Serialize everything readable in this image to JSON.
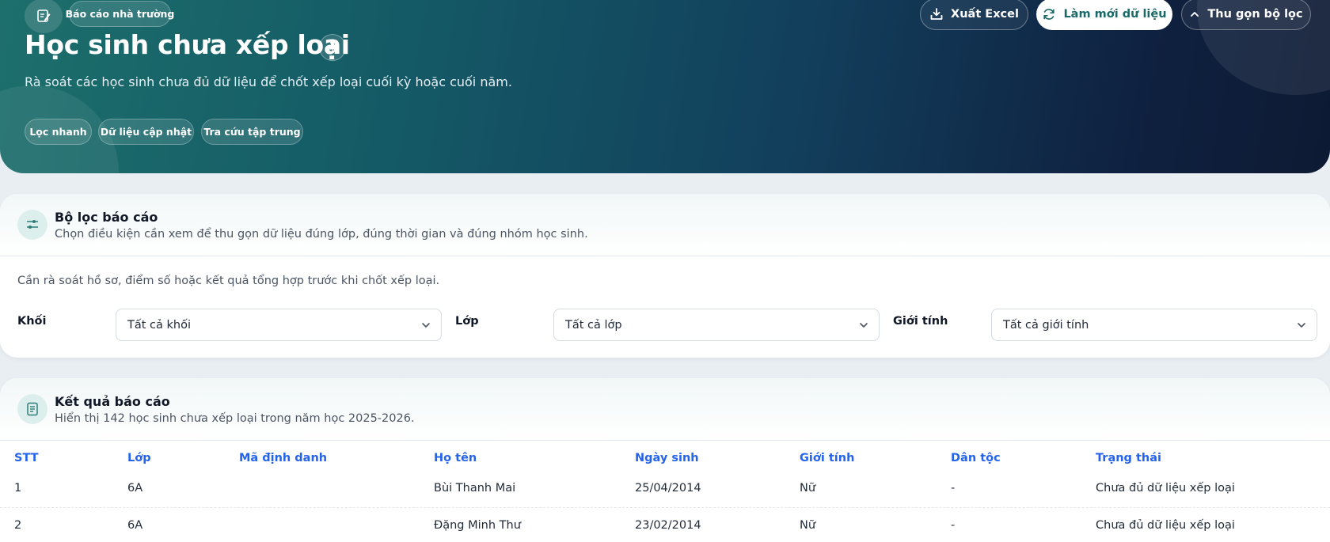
{
  "hero": {
    "badge": "Báo cáo nhà trường",
    "title": "Học sinh chưa xếp loại",
    "subtitle": "Rà soát các học sinh chưa đủ dữ liệu để chốt xếp loại cuối kỳ hoặc cuối năm.",
    "chips": [
      "Lọc nhanh",
      "Dữ liệu cập nhật",
      "Tra cứu tập trung"
    ],
    "actions": {
      "export": "Xuất Excel",
      "refresh": "Làm mới dữ liệu",
      "collapse": "Thu gọn bộ lọc"
    }
  },
  "filters": {
    "title": "Bộ lọc báo cáo",
    "description": "Chọn điều kiện cần xem để thu gọn dữ liệu đúng lớp, đúng thời gian và đúng nhóm học sinh.",
    "note": "Cần rà soát hồ sơ, điểm số hoặc kết quả tổng hợp trước khi chốt xếp loại.",
    "fields": [
      {
        "label": "Khối",
        "value": "Tất cả khối"
      },
      {
        "label": "Lớp",
        "value": "Tất cả lớp"
      },
      {
        "label": "Giới tính",
        "value": "Tất cả giới tính"
      }
    ]
  },
  "results": {
    "title": "Kết quả báo cáo",
    "description": "Hiển thị 142 học sinh chưa xếp loại trong năm học 2025-2026.",
    "columns": [
      "STT",
      "Lớp",
      "Mã định danh",
      "Họ tên",
      "Ngày sinh",
      "Giới tính",
      "Dân tộc",
      "Trạng thái"
    ],
    "rows": [
      [
        "1",
        "6A",
        "",
        "Bùi Thanh Mai",
        "25/04/2014",
        "Nữ",
        "-",
        "Chưa đủ dữ liệu xếp loại"
      ],
      [
        "2",
        "6A",
        "",
        "Đặng Minh Thư",
        "23/02/2014",
        "Nữ",
        "-",
        "Chưa đủ dữ liệu xếp loại"
      ]
    ]
  },
  "colors": {
    "hero_start": "#1d6f6c",
    "hero_end": "#0d1a33",
    "accent_teal": "#1a6a6a",
    "column_header_blue": "#2563eb"
  },
  "icons": {
    "badge": "edit-document-icon",
    "pin": "pin-icon",
    "export": "download-icon",
    "refresh": "refresh-icon",
    "collapse": "chevron-up-icon",
    "filters": "sliders-icon",
    "results": "document-list-icon",
    "select": "chevron-down-icon"
  }
}
